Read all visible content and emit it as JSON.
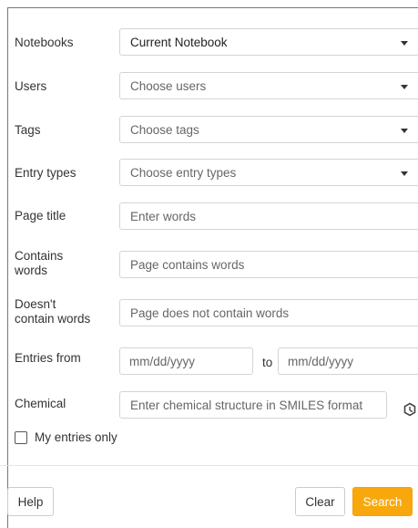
{
  "filters": {
    "notebooks": {
      "label": "Notebooks",
      "value": "Current Notebook"
    },
    "users": {
      "label": "Users",
      "placeholder": "Choose users"
    },
    "tags": {
      "label": "Tags",
      "placeholder": "Choose tags"
    },
    "entry_types": {
      "label": "Entry types",
      "placeholder": "Choose entry types"
    },
    "page_title": {
      "label": "Page title",
      "placeholder": "Enter words"
    },
    "contains_words": {
      "label_line1": "Contains",
      "label_line2": "words",
      "placeholder": "Page contains words"
    },
    "doesnt_contain": {
      "label_line1": "Doesn't",
      "label_line2": "contain words",
      "placeholder": "Page does not contain words"
    },
    "entries_from": {
      "label": "Entries from",
      "from_placeholder": "mm/dd/yyyy",
      "to_label": "to",
      "to_placeholder": "mm/dd/yyyy"
    },
    "chemical": {
      "label": "Chemical",
      "placeholder": "Enter chemical structure in SMILES format",
      "icon": "chemical-structure-icon"
    }
  },
  "my_entries_only": {
    "label": "My entries only",
    "checked": false
  },
  "buttons": {
    "help": "Help",
    "clear": "Clear",
    "search": "Search"
  },
  "colors": {
    "accent": "#f8a80c",
    "border": "#d4d4d4"
  }
}
